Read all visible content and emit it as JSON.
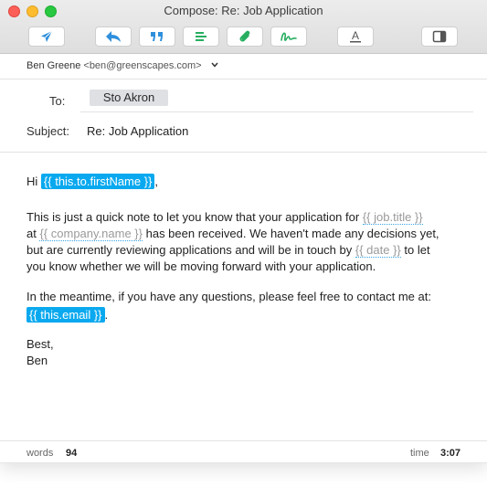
{
  "window": {
    "title": "Compose: Re: Job Application"
  },
  "toolbar": {
    "buttons": [
      {
        "name": "send",
        "icon": "paper-plane-icon"
      },
      {
        "name": "reply",
        "icon": "reply-arrow-icon"
      },
      {
        "name": "quote",
        "icon": "quote-icon"
      },
      {
        "name": "align",
        "icon": "align-left-icon"
      },
      {
        "name": "attach",
        "icon": "paperclip-icon"
      },
      {
        "name": "signature",
        "icon": "signature-icon"
      },
      {
        "name": "format",
        "icon": "text-format-icon",
        "glyph": "A"
      },
      {
        "name": "sidebar",
        "icon": "sidebar-toggle-icon"
      }
    ],
    "accent": "#2f8fdc",
    "signature_color": "#27ae60"
  },
  "from": {
    "name": "Ben Greene",
    "address": "<ben@greenscapes.com>"
  },
  "to": {
    "label": "To:",
    "recipient": "Sto Akron"
  },
  "subject": {
    "label": "Subject:",
    "value": "Re: Job Application"
  },
  "body": {
    "greeting": "Hi",
    "var_first_name": "{{ this.to.firstName }}",
    "greeting_end": ",",
    "p2_l1_a": "This is just a quick note to let you know that your application for",
    "var_job_title": "{{ job.title }}",
    "p2_l2_a": "at",
    "var_company_name": "{{ company.name }}",
    "p2_l2_b": "has been received. We haven't made any decisions yet,",
    "p2_l3_a": "but are currently reviewing applications and will be in touch by",
    "var_date": "{{ date }}",
    "p2_l3_b": "to let",
    "p2_l4": "you know whether we will be moving forward with your application.",
    "p3_l1": "In the meantime, if you have any questions, please feel free to contact me at:",
    "var_email": "{{ this.email }}",
    "p3_end": ".",
    "sign_off": "Best,",
    "sign_name": "Ben"
  },
  "status": {
    "words_label": "words",
    "words_value": "94",
    "time_label": "time",
    "time_value": "3:07"
  }
}
